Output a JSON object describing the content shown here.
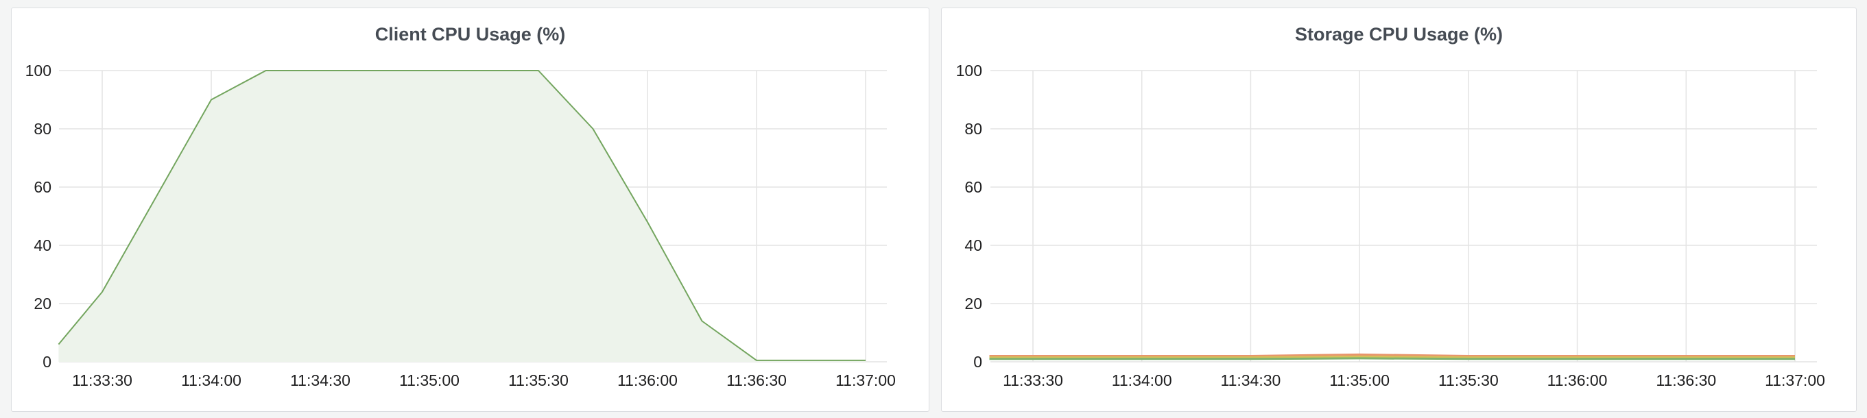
{
  "chart_data": [
    {
      "type": "area",
      "title": "Client CPU Usage (%)",
      "ylim": [
        0,
        100
      ],
      "yticks": [
        0,
        20,
        40,
        60,
        80,
        100
      ],
      "xticks": [
        "11:33:30",
        "11:34:00",
        "11:34:30",
        "11:35:00",
        "11:35:30",
        "11:36:00",
        "11:36:30",
        "11:37:00"
      ],
      "grid": true,
      "series": [
        {
          "color": "#73a55e",
          "fill": "#edf3eb",
          "points": [
            [
              "11:33:18",
              6
            ],
            [
              "11:33:30",
              24
            ],
            [
              "11:34:00",
              90
            ],
            [
              "11:34:15",
              100
            ],
            [
              "11:34:30",
              100
            ],
            [
              "11:35:00",
              100
            ],
            [
              "11:35:30",
              100
            ],
            [
              "11:35:45",
              80
            ],
            [
              "11:36:00",
              48
            ],
            [
              "11:36:15",
              14
            ],
            [
              "11:36:30",
              0.5
            ],
            [
              "11:37:00",
              0.5
            ]
          ]
        }
      ]
    },
    {
      "type": "line",
      "title": "Storage CPU Usage (%)",
      "ylim": [
        0,
        100
      ],
      "yticks": [
        0,
        20,
        40,
        60,
        80,
        100
      ],
      "xticks": [
        "11:33:30",
        "11:34:00",
        "11:34:30",
        "11:35:00",
        "11:35:30",
        "11:36:00",
        "11:36:30",
        "11:37:00"
      ],
      "grid": true,
      "series": [
        {
          "color": "#e8956b",
          "points": [
            [
              "11:33:18",
              2
            ],
            [
              "11:34:30",
              2
            ],
            [
              "11:35:00",
              2.5
            ],
            [
              "11:35:30",
              2
            ],
            [
              "11:37:00",
              2
            ]
          ]
        },
        {
          "color": "#d4c15a",
          "points": [
            [
              "11:33:18",
              1.5
            ],
            [
              "11:34:30",
              1.5
            ],
            [
              "11:35:00",
              1.8
            ],
            [
              "11:35:30",
              1.5
            ],
            [
              "11:37:00",
              1.5
            ]
          ]
        },
        {
          "color": "#7eb26d",
          "points": [
            [
              "11:33:18",
              1
            ],
            [
              "11:34:30",
              1
            ],
            [
              "11:35:00",
              1.2
            ],
            [
              "11:35:30",
              1
            ],
            [
              "11:37:00",
              1
            ]
          ]
        }
      ]
    }
  ]
}
